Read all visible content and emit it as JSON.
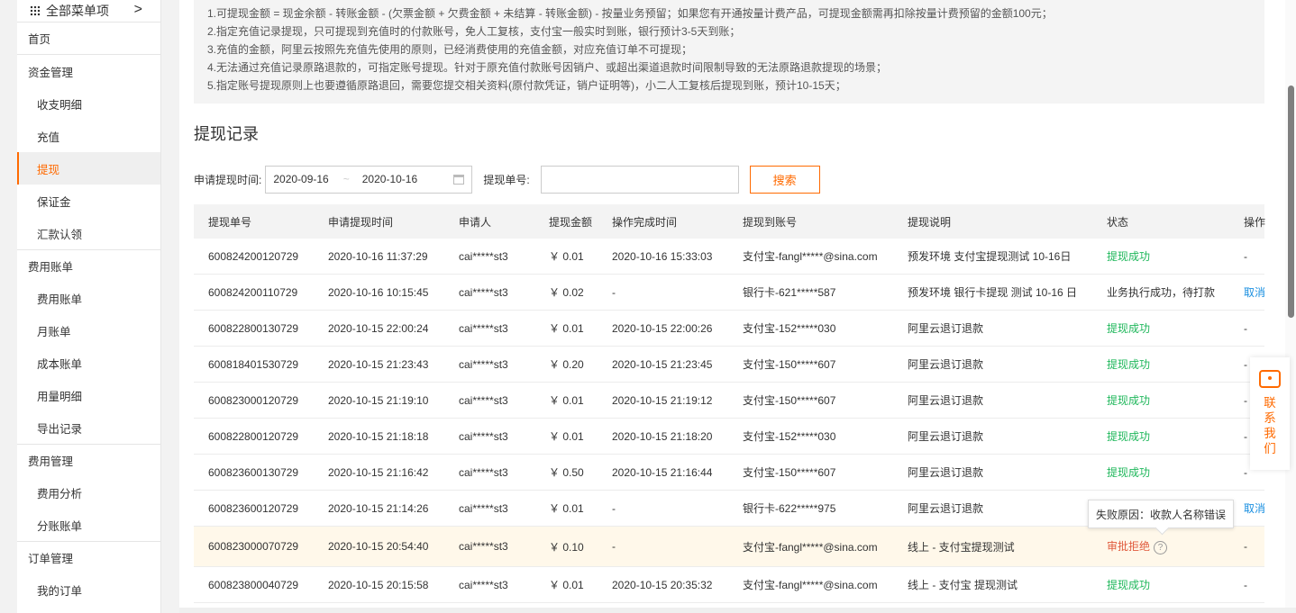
{
  "sidebar": {
    "menu_label": "全部菜单项",
    "chevron": ">",
    "home": "首页",
    "groups": [
      {
        "label": "资金管理",
        "items": [
          "收支明细",
          "充值",
          "提现",
          "保证金",
          "汇款认领"
        ]
      },
      {
        "label": "费用账单",
        "items": [
          "费用账单",
          "月账单",
          "成本账单",
          "用量明细",
          "导出记录"
        ]
      },
      {
        "label": "费用管理",
        "items": [
          "费用分析",
          "分账账单"
        ]
      },
      {
        "label": "订单管理",
        "items": [
          "我的订单"
        ]
      }
    ],
    "active_item": "提现",
    "accent_color": "#ff6a00"
  },
  "notice": {
    "lines": [
      "1.可提现金额 = 现金余额 - 转账金额 - (欠票金额 + 欠费金额 + 未结算 - 转账金额) - 按量业务预留；如果您有开通按量计费产品，可提现金额需再扣除按量计费预留的金额100元；",
      "2.指定充值记录提现，只可提现到充值时的付款账号，免人工复核，支付宝一般实时到账，银行预计3-5天到账；",
      "3.充值的金额，阿里云按照先充值先使用的原则，已经消费使用的充值金额，对应充值订单不可提现；",
      "4.无法通过充值记录原路退款的，可指定账号提现。针对于原充值付款账号因销户、或超出渠道退款时间限制导致的无法原路退款提现的场景；",
      "5.指定账号提现原则上也要遵循原路退回，需要您提交相关资料(原付款凭证，销户证明等)，小二人工复核后提现到账，预计10-15天；"
    ]
  },
  "section_title": "提现记录",
  "filters": {
    "date_label": "申请提现时间:",
    "start_date": "2020-09-16",
    "range_sep": "~",
    "end_date": "2020-10-16",
    "order_label": "提现单号:",
    "order_value": "",
    "search_label": "搜索"
  },
  "table": {
    "headers": [
      "提现单号",
      "申请提现时间",
      "申请人",
      "提现金额",
      "操作完成时间",
      "提现到账号",
      "提现说明",
      "状态",
      "操作"
    ],
    "rows": [
      [
        "600824200120729",
        "2020-10-16 11:37:29",
        "cai*****st3",
        "￥ 0.01",
        "2020-10-16 15:33:03",
        "支付宝-fangl*****@sina.com",
        "预发环境 支付宝提现测试 10-16日",
        "提现成功",
        "-"
      ],
      [
        "600824200110729",
        "2020-10-16 10:15:45",
        "cai*****st3",
        "￥ 0.02",
        "-",
        "银行卡-621*****587",
        "预发环境 银行卡提现 测试 10-16 日",
        "业务执行成功，待打款",
        "取消"
      ],
      [
        "600822800130729",
        "2020-10-15 22:00:24",
        "cai*****st3",
        "￥ 0.01",
        "2020-10-15 22:00:26",
        "支付宝-152*****030",
        "阿里云退订退款",
        "提现成功",
        "-"
      ],
      [
        "600818401530729",
        "2020-10-15 21:23:43",
        "cai*****st3",
        "￥ 0.20",
        "2020-10-15 21:23:45",
        "支付宝-150*****607",
        "阿里云退订退款",
        "提现成功",
        "-"
      ],
      [
        "600823000120729",
        "2020-10-15 21:19:10",
        "cai*****st3",
        "￥ 0.01",
        "2020-10-15 21:19:12",
        "支付宝-150*****607",
        "阿里云退订退款",
        "提现成功",
        "-"
      ],
      [
        "600822800120729",
        "2020-10-15 21:18:18",
        "cai*****st3",
        "￥ 0.01",
        "2020-10-15 21:18:20",
        "支付宝-152*****030",
        "阿里云退订退款",
        "提现成功",
        "-"
      ],
      [
        "600823600130729",
        "2020-10-15 21:16:42",
        "cai*****st3",
        "￥ 0.50",
        "2020-10-15 21:16:44",
        "支付宝-150*****607",
        "阿里云退订退款",
        "提现成功",
        "-"
      ],
      [
        "600823600120729",
        "2020-10-15 21:14:26",
        "cai*****st3",
        "￥ 0.01",
        "-",
        "银行卡-622*****975",
        "阿里云退订退款",
        "",
        "取消"
      ],
      [
        "600823000070729",
        "2020-10-15 20:54:40",
        "cai*****st3",
        "￥ 0.10",
        "-",
        "支付宝-fangl*****@sina.com",
        "线上 - 支付宝提现测试",
        "审批拒绝",
        "-"
      ],
      [
        "600823800040729",
        "2020-10-15 20:15:58",
        "cai*****st3",
        "￥ 0.01",
        "2020-10-15 20:35:32",
        "支付宝-fangl*****@sina.com",
        "线上 - 支付宝 提现测试",
        "提现成功",
        "-"
      ]
    ],
    "status_colors": {
      "success": "#1fb75b",
      "rejected": "#e05a3c",
      "link": "#1a8fe0"
    }
  },
  "tooltip": "失败原因：收款人名称错误",
  "contact": {
    "label": "联系我们"
  }
}
